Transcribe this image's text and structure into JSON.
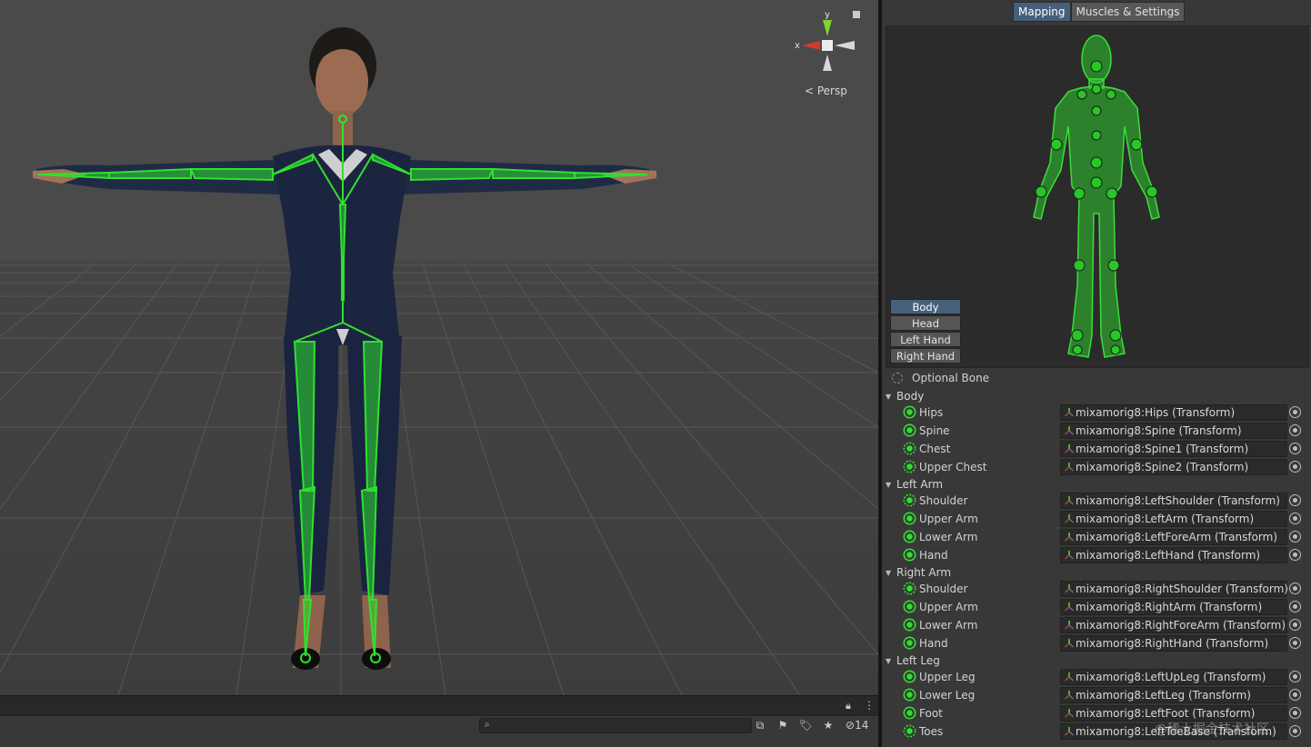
{
  "scene": {
    "gizmo": {
      "y_label": "y",
      "x_label": "x",
      "projection_label": "< Persp"
    },
    "colors": {
      "bone_green": "#2fe12f",
      "suit": "#1c2540",
      "grid": "#5a5a5a"
    }
  },
  "scene_footer": {
    "lock_icon": "lock-icon",
    "menu_icon": "kebab-menu-icon",
    "search_icon": "search-icon",
    "hidden_count": "14"
  },
  "inspector": {
    "tabs": [
      {
        "label": "Mapping",
        "active": true
      },
      {
        "label": "Muscles & Settings",
        "active": false
      }
    ],
    "body_parts": [
      "Body",
      "Head",
      "Left Hand",
      "Right Hand"
    ],
    "optional_bone_label": "Optional Bone",
    "groups": [
      {
        "name": "Body",
        "bones": [
          {
            "label": "Hips",
            "value": "mixamorig8:Hips (Transform)",
            "optional": false
          },
          {
            "label": "Spine",
            "value": "mixamorig8:Spine (Transform)",
            "optional": false
          },
          {
            "label": "Chest",
            "value": "mixamorig8:Spine1 (Transform)",
            "optional": true
          },
          {
            "label": "Upper Chest",
            "value": "mixamorig8:Spine2 (Transform)",
            "optional": true
          }
        ]
      },
      {
        "name": "Left Arm",
        "bones": [
          {
            "label": "Shoulder",
            "value": "mixamorig8:LeftShoulder (Transform)",
            "optional": true
          },
          {
            "label": "Upper Arm",
            "value": "mixamorig8:LeftArm (Transform)",
            "optional": false
          },
          {
            "label": "Lower Arm",
            "value": "mixamorig8:LeftForeArm (Transform)",
            "optional": false
          },
          {
            "label": "Hand",
            "value": "mixamorig8:LeftHand (Transform)",
            "optional": false
          }
        ]
      },
      {
        "name": "Right Arm",
        "bones": [
          {
            "label": "Shoulder",
            "value": "mixamorig8:RightShoulder (Transform)",
            "optional": true
          },
          {
            "label": "Upper Arm",
            "value": "mixamorig8:RightArm (Transform)",
            "optional": false
          },
          {
            "label": "Lower Arm",
            "value": "mixamorig8:RightForeArm (Transform)",
            "optional": false
          },
          {
            "label": "Hand",
            "value": "mixamorig8:RightHand (Transform)",
            "optional": false
          }
        ]
      },
      {
        "name": "Left Leg",
        "bones": [
          {
            "label": "Upper Leg",
            "value": "mixamorig8:LeftUpLeg (Transform)",
            "optional": false
          },
          {
            "label": "Lower Leg",
            "value": "mixamorig8:LeftLeg (Transform)",
            "optional": false
          },
          {
            "label": "Foot",
            "value": "mixamorig8:LeftFoot (Transform)",
            "optional": false
          },
          {
            "label": "Toes",
            "value": "mixamorig8:LeftToeBase (Transform)",
            "optional": true
          }
        ]
      }
    ],
    "watermark": "@稀土掘金技术社区"
  }
}
